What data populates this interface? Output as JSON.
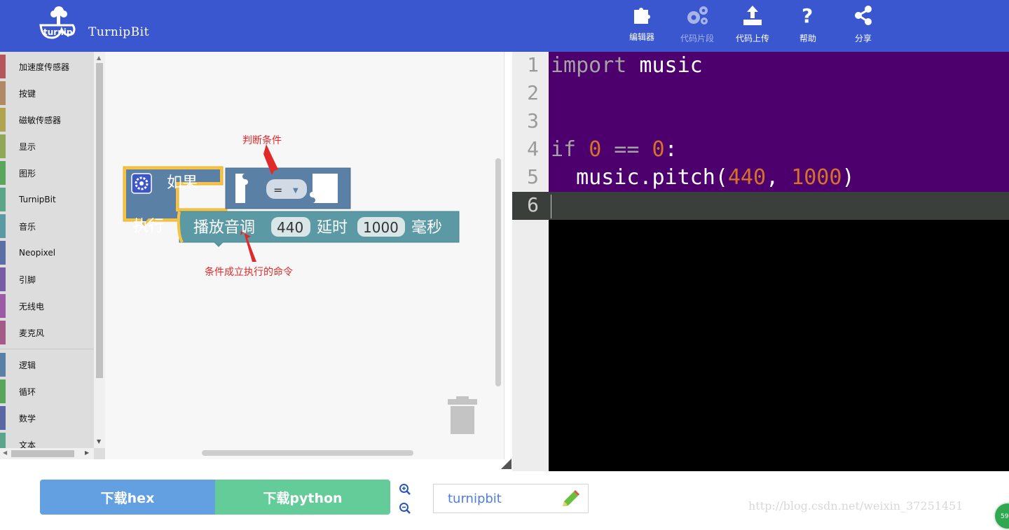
{
  "header": {
    "title": "TurnipBit",
    "nav": [
      {
        "label": "编辑器",
        "icon": "puzzle-icon",
        "active": true
      },
      {
        "label": "代码片段",
        "icon": "gears-icon",
        "active": false
      },
      {
        "label": "代码上传",
        "icon": "upload-icon",
        "active": true
      },
      {
        "label": "帮助",
        "icon": "help-icon",
        "active": true
      },
      {
        "label": "分享",
        "icon": "share-icon",
        "active": true
      }
    ]
  },
  "toolbox": {
    "categories": [
      {
        "label": "加速度传感器",
        "color": "#b5565c"
      },
      {
        "label": "按键",
        "color": "#b08a64"
      },
      {
        "label": "磁敏传感器",
        "color": "#b0a451"
      },
      {
        "label": "显示",
        "color": "#8fa757"
      },
      {
        "label": "图形",
        "color": "#5ba65c"
      },
      {
        "label": "TurnipBit",
        "color": "#5ba58a"
      },
      {
        "label": "音乐",
        "color": "#5b9aa5"
      },
      {
        "label": "Neopixel",
        "color": "#5b6fa5"
      },
      {
        "label": "引脚",
        "color": "#7a5ba5"
      },
      {
        "label": "无线电",
        "color": "#9b5ba5"
      },
      {
        "label": "麦克风",
        "color": "#a55b87"
      },
      {
        "label": "逻辑",
        "color": "#5b80a5"
      },
      {
        "label": "循环",
        "color": "#5ba55b"
      },
      {
        "label": "数学",
        "color": "#5b67a5"
      },
      {
        "label": "文本",
        "color": "#5ba58c"
      }
    ]
  },
  "blocks": {
    "if_label": "如果",
    "do_label": "执行",
    "operator": "=",
    "pitch_label": "播放音调",
    "pitch_value": "440",
    "delay_label": "延时",
    "delay_value": "1000",
    "ms_label": "毫秒"
  },
  "annotations": {
    "condition": "判断条件",
    "command": "条件成立执行的命令"
  },
  "code": {
    "line_numbers": [
      "1",
      "2",
      "3",
      "4",
      "5",
      "6"
    ],
    "line1_kw": "import",
    "line1_rest": " music",
    "line4_kw": "if",
    "line4_a": "0",
    "line4_op": " == ",
    "line4_b": "0",
    "line4_colon": ":",
    "line5_a": "  music.pitch(",
    "line5_n1": "440",
    "line5_sep": ", ",
    "line5_n2": "1000",
    "line5_end": ")"
  },
  "bottom": {
    "download_hex": "下载hex",
    "download_python": "下载python",
    "project_name": "turnipbit",
    "watermark": "http://blog.csdn.net/weixin_37251451",
    "badge": "59"
  },
  "colors": {
    "header_bg": "#3a57d0",
    "block_main": "#5b80a5",
    "block_hat_border": "#f6c342",
    "block_music": "#5b9aa5",
    "code_purple": "#4d006d",
    "number_orange": "#d4712a"
  }
}
